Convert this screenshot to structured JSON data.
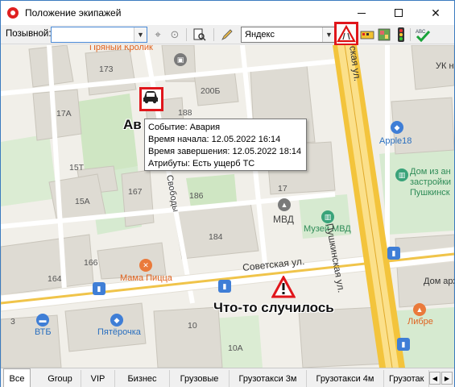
{
  "window": {
    "title": "Положение экипажей"
  },
  "toolbar": {
    "callsign_label": "Позывной:",
    "callsign_value": "",
    "provider_value": "Яндекс"
  },
  "map": {
    "house_numbers": [
      "173",
      "188",
      "200Б",
      "17А",
      "17",
      "15Т",
      "15А",
      "167",
      "186",
      "184",
      "166",
      "164",
      "10",
      "10А",
      "3"
    ],
    "poi": {
      "pryaniy": "Пряный Кролик",
      "apple": "Apple18",
      "dom_iz": "Дом из ан",
      "zastroika": "застройки",
      "pushkinsk": "Пушкинск",
      "uk": "УК н",
      "mvd": "МВД",
      "muzey": "Музей МВД",
      "mama": "Мама Пицца",
      "vtb": "ВТБ",
      "pyaterochka": "Пятёрочка",
      "libre": "Либре",
      "dom_arh": "Дом арх"
    },
    "streets": {
      "pushkinskaya": "Пушкинская ул.",
      "pushkinskaya_top": "ская ул.",
      "sovetskaya": "Советская ул.",
      "svobody": "Свободы"
    },
    "car_label": "Ав",
    "event_label": "Что-то случилось"
  },
  "tooltip": {
    "event": "Событие: Авария",
    "start": "Время начала: 12.05.2022 16:14",
    "end": "Время завершения: 12.05.2022 18:14",
    "attrs": "Атрибуты: Есть ущерб ТС"
  },
  "tabs": [
    "Все",
    "Group",
    "VIP",
    "Бизнес",
    "Грузовые",
    "Грузотакси 3м",
    "Грузотакси 4м",
    "Грузотак"
  ]
}
